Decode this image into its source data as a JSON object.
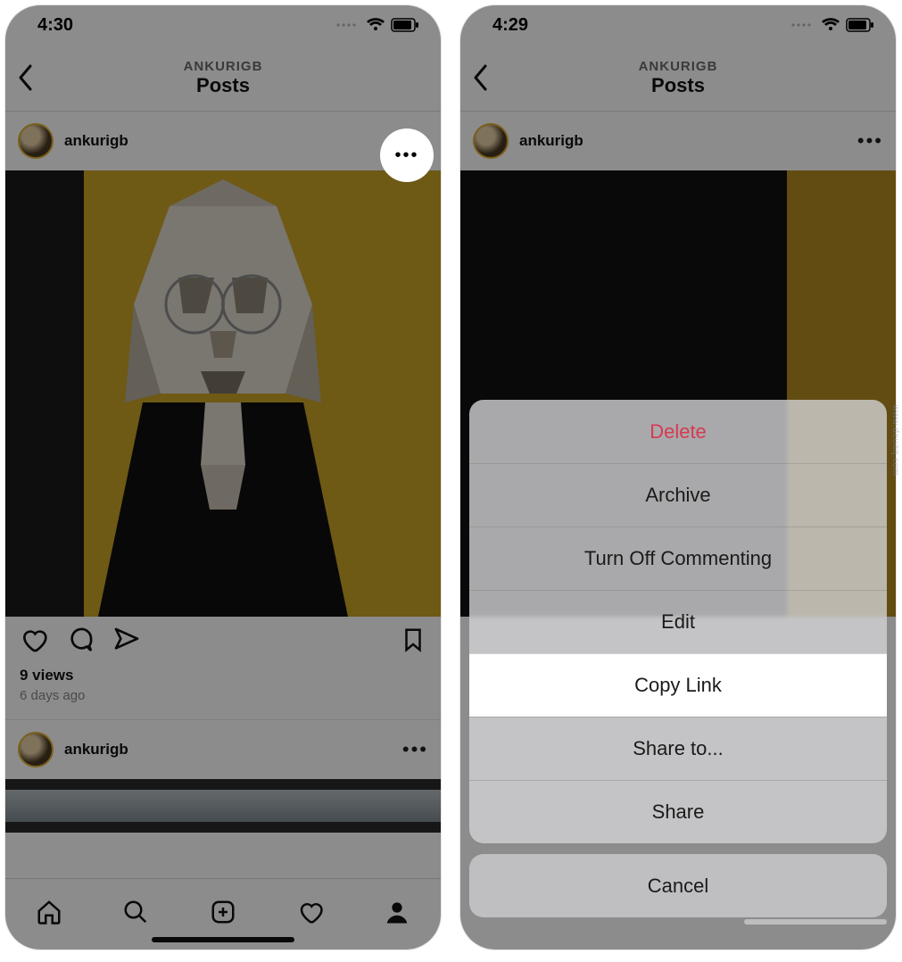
{
  "left": {
    "status_time": "4:30",
    "header_user": "ANKURIGB",
    "header_title": "Posts",
    "post_user": "ankurigb",
    "views": "9 views",
    "time": "6 days ago",
    "post2_user": "ankurigb"
  },
  "right": {
    "status_time": "4:29",
    "header_user": "ANKURIGB",
    "header_title": "Posts",
    "post_user": "ankurigb",
    "sheet": {
      "delete": "Delete",
      "archive": "Archive",
      "turn_off": "Turn Off Commenting",
      "edit": "Edit",
      "copy_link": "Copy Link",
      "share_to": "Share to...",
      "share": "Share",
      "cancel": "Cancel"
    }
  },
  "watermark": "www.deuaq.com"
}
